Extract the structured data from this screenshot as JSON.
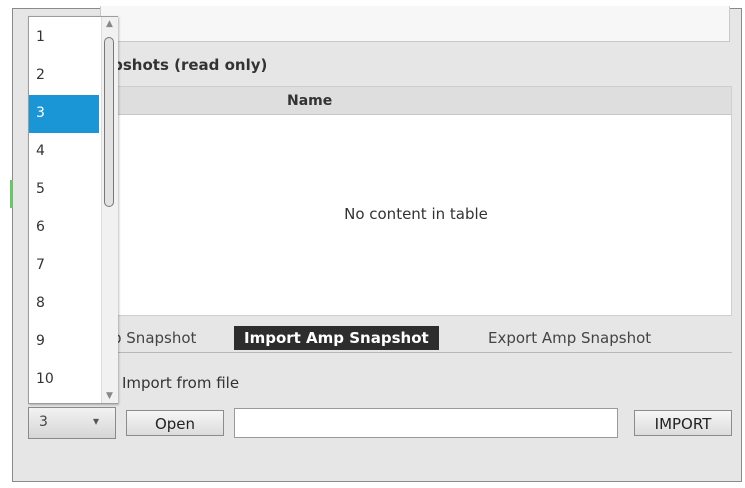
{
  "section": {
    "title": "Snapshots (read only)",
    "title_visible": "apshots (read only)"
  },
  "table": {
    "columns": [
      "Name"
    ],
    "empty_text": "No content in table"
  },
  "tabs": [
    {
      "label": "p Snapshot",
      "active": false
    },
    {
      "label": "Import Amp Snapshot",
      "active": true
    },
    {
      "label": "Export Amp Snapshot",
      "active": false
    }
  ],
  "import": {
    "label": "Import from file",
    "open_button": "Open",
    "path_value": "",
    "import_button": "IMPORT"
  },
  "combo": {
    "value": "3",
    "arrow_icon": "chevron-down-icon"
  },
  "dropdown": {
    "options": [
      "1",
      "2",
      "3",
      "4",
      "5",
      "6",
      "7",
      "8",
      "9",
      "10"
    ],
    "selected": "3"
  },
  "colors": {
    "selection": "#1a96d6",
    "active_tab": "#2d2d2d"
  }
}
